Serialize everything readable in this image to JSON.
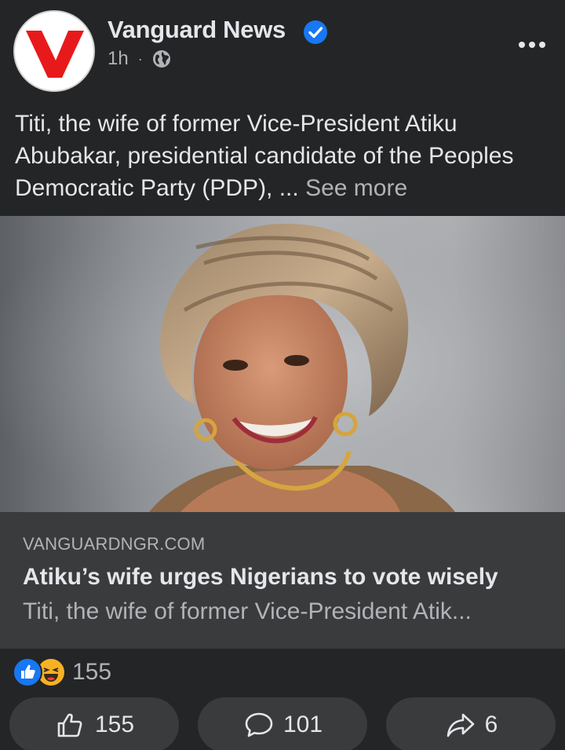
{
  "post": {
    "page_name": "Vanguard News",
    "logo_letter": "V",
    "time": "1h",
    "separator": "·",
    "text": "Titi, the wife of former Vice-President Atiku Abubakar, presidential candidate of the Peoples Democratic Party (PDP), ...",
    "see_more": "See more"
  },
  "link_preview": {
    "domain": "VANGUARDNGR.COM",
    "title": "Atiku’s wife urges Nigerians to vote wisely",
    "description": "Titi, the wife of former Vice-President Atik..."
  },
  "reactions": {
    "count": "155",
    "types": [
      "like-icon",
      "haha-icon"
    ]
  },
  "actions": {
    "like_count": "155",
    "comment_count": "101",
    "share_count": "6"
  },
  "colors": {
    "background": "#242526",
    "card": "#3a3b3c",
    "text_primary": "#e4e6eb",
    "text_secondary": "#b0b3b8",
    "verified_blue": "#1877f2",
    "logo_red": "#e8191b"
  }
}
